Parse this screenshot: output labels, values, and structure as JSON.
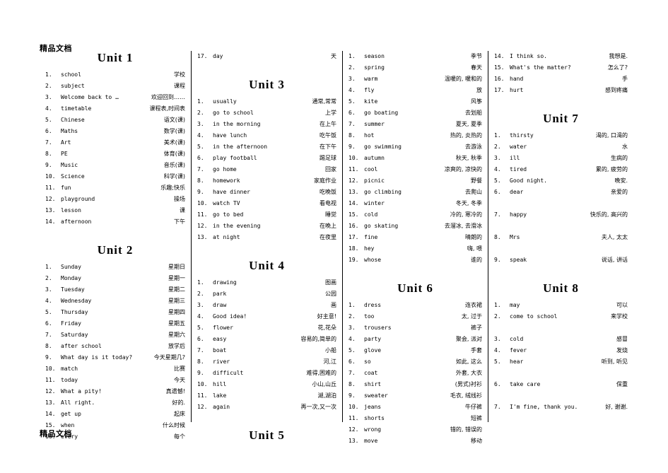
{
  "watermark": {
    "top": "精品文档",
    "bottom": "精品文档"
  },
  "columns": [
    {
      "blocks": [
        {
          "type": "unit",
          "title": "Unit 1",
          "entries": [
            {
              "n": "1.",
              "en": "school",
              "cn": "学校"
            },
            {
              "n": "2.",
              "en": "subject",
              "cn": "课程"
            },
            {
              "n": "3.",
              "en": "Welcome back to …",
              "cn": "欢迎回到……"
            },
            {
              "n": "4.",
              "en": "timetable",
              "cn": "课程表,时间表"
            },
            {
              "n": "5.",
              "en": "Chinese",
              "cn": "语文(课)"
            },
            {
              "n": "6.",
              "en": "Maths",
              "cn": "数学(课)"
            },
            {
              "n": "7.",
              "en": "Art",
              "cn": "美术(课)"
            },
            {
              "n": "8.",
              "en": "PE",
              "cn": "体育(课)"
            },
            {
              "n": "9.",
              "en": "Music",
              "cn": "音乐(课)"
            },
            {
              "n": "10.",
              "en": "Science",
              "cn": "科学(课)"
            },
            {
              "n": "11.",
              "en": "fun",
              "cn": "乐趣;快乐"
            },
            {
              "n": "12.",
              "en": "playground",
              "cn": "操场"
            },
            {
              "n": "13.",
              "en": "lesson",
              "cn": "课"
            },
            {
              "n": "14.",
              "en": "afternoon",
              "cn": "下午"
            }
          ]
        },
        {
          "type": "unit",
          "title": "Unit 2",
          "entries": [
            {
              "n": "1.",
              "en": "Sunday",
              "cn": "星期日"
            },
            {
              "n": "2.",
              "en": "Monday",
              "cn": "星期一"
            },
            {
              "n": "3.",
              "en": "Tuesday",
              "cn": "星期二"
            },
            {
              "n": "4.",
              "en": "Wednesday",
              "cn": "星期三"
            },
            {
              "n": "5.",
              "en": "Thursday",
              "cn": "星期四"
            },
            {
              "n": "6.",
              "en": "Friday",
              "cn": "星期五"
            },
            {
              "n": "7.",
              "en": "Saturday",
              "cn": "星期六"
            },
            {
              "n": "8.",
              "en": "after school",
              "cn": "放学后"
            },
            {
              "n": "9.",
              "en": "What day is it today?",
              "cn": "今天星期几?"
            },
            {
              "n": "10.",
              "en": "match",
              "cn": "比赛"
            },
            {
              "n": "11.",
              "en": "today",
              "cn": "今天"
            },
            {
              "n": "12.",
              "en": "What a pity!",
              "cn": "真遗憾!"
            },
            {
              "n": "13.",
              "en": "All right.",
              "cn": "好的."
            },
            {
              "n": "14.",
              "en": "get up",
              "cn": "起床"
            },
            {
              "n": "15.",
              "en": "when",
              "cn": "什么时候"
            },
            {
              "n": "16.",
              "en": "every",
              "cn": "每个"
            }
          ]
        }
      ]
    },
    {
      "blocks": [
        {
          "type": "entries-only",
          "entries": [
            {
              "n": "17.",
              "en": "day",
              "cn": "天"
            }
          ]
        },
        {
          "type": "unit",
          "title": "Unit 3",
          "entries": [
            {
              "n": "1.",
              "en": "usually",
              "cn": "通常,常常"
            },
            {
              "n": "2.",
              "en": "go to school",
              "cn": "上学"
            },
            {
              "n": "3.",
              "en": "in the morning",
              "cn": "在上午"
            },
            {
              "n": "4.",
              "en": "have lunch",
              "cn": "吃午饭"
            },
            {
              "n": "5.",
              "en": "in the afternoon",
              "cn": "在下午"
            },
            {
              "n": "6.",
              "en": "play football",
              "cn": "踢足球"
            },
            {
              "n": "7.",
              "en": "go home",
              "cn": "回家"
            },
            {
              "n": "8.",
              "en": "homework",
              "cn": "家庭作业"
            },
            {
              "n": "9.",
              "en": "have dinner",
              "cn": "吃晚饭"
            },
            {
              "n": "10.",
              "en": "watch TV",
              "cn": "看电视"
            },
            {
              "n": "11.",
              "en": "go to bed",
              "cn": "睡觉"
            },
            {
              "n": "12.",
              "en": "in the evening",
              "cn": "在晚上"
            },
            {
              "n": "13.",
              "en": "at night",
              "cn": "在夜里"
            }
          ]
        },
        {
          "type": "unit",
          "title": "Unit 4",
          "entries": [
            {
              "n": "1.",
              "en": "drawing",
              "cn": "图画"
            },
            {
              "n": "2.",
              "en": "park",
              "cn": "公园"
            },
            {
              "n": "3.",
              "en": "draw",
              "cn": "画"
            },
            {
              "n": "4.",
              "en": "Good idea!",
              "cn": "好主意!"
            },
            {
              "n": "5.",
              "en": "flower",
              "cn": "花,花朵"
            },
            {
              "n": "6.",
              "en": "easy",
              "cn": "容易的,简单的"
            },
            {
              "n": "7.",
              "en": "boat",
              "cn": "小船"
            },
            {
              "n": "8.",
              "en": "river",
              "cn": "河,江"
            },
            {
              "n": "9.",
              "en": "difficult",
              "cn": "难得,困难的"
            },
            {
              "n": "10.",
              "en": "hill",
              "cn": "小山,山丘"
            },
            {
              "n": "11.",
              "en": "lake",
              "cn": "湖,湖泊"
            },
            {
              "n": "12.",
              "en": "again",
              "cn": "再一次,又一次"
            }
          ]
        },
        {
          "type": "title-only",
          "title": "Unit 5"
        }
      ]
    },
    {
      "blocks": [
        {
          "type": "entries-only",
          "entries": [
            {
              "n": "1.",
              "en": "season",
              "cn": "季节"
            },
            {
              "n": "2.",
              "en": "spring",
              "cn": "春天"
            },
            {
              "n": "3.",
              "en": "warm",
              "cn": "温暖的, 暖和的"
            },
            {
              "n": "4.",
              "en": "fly",
              "cn": "放"
            },
            {
              "n": "5.",
              "en": "kite",
              "cn": "风筝"
            },
            {
              "n": "6.",
              "en": "go boating",
              "cn": "去划船"
            },
            {
              "n": "7.",
              "en": "summer",
              "cn": "夏天, 夏季"
            },
            {
              "n": "8.",
              "en": "hot",
              "cn": "热的, 炎热的"
            },
            {
              "n": "9.",
              "en": "go swimming",
              "cn": "去游泳"
            },
            {
              "n": "10.",
              "en": "autumn",
              "cn": "秋天, 秋季"
            },
            {
              "n": "11.",
              "en": "cool",
              "cn": "凉爽的, 凉快的"
            },
            {
              "n": "12.",
              "en": "picnic",
              "cn": "野餐"
            },
            {
              "n": "13.",
              "en": "go climbing",
              "cn": "去爬山"
            },
            {
              "n": "14.",
              "en": "winter",
              "cn": "冬天, 冬季"
            },
            {
              "n": "15.",
              "en": "cold",
              "cn": "冷的, 寒冷的"
            },
            {
              "n": "16.",
              "en": "go skating",
              "cn": "去溜冰, 去滑冰"
            },
            {
              "n": "17.",
              "en": "fine",
              "cn": "晴朗的"
            },
            {
              "n": "18.",
              "en": "hey",
              "cn": "嗨, 喂"
            },
            {
              "n": "19.",
              "en": "whose",
              "cn": "谁的"
            }
          ]
        },
        {
          "type": "unit",
          "title": "Unit 6",
          "entries": [
            {
              "n": "1.",
              "en": "dress",
              "cn": "连衣裙"
            },
            {
              "n": "2.",
              "en": "too",
              "cn": "太, 过于"
            },
            {
              "n": "3.",
              "en": "trousers",
              "cn": "裤子"
            },
            {
              "n": "4.",
              "en": "party",
              "cn": "聚会, 派对"
            },
            {
              "n": "5.",
              "en": "glove",
              "cn": "手套"
            },
            {
              "n": "6.",
              "en": "so",
              "cn": "如此, 这么"
            },
            {
              "n": "7.",
              "en": "coat",
              "cn": "外套, 大衣"
            },
            {
              "n": "8.",
              "en": "shirt",
              "cn": "(男式)衬衫"
            },
            {
              "n": "9.",
              "en": "sweater",
              "cn": "毛衣, 绒线衫"
            },
            {
              "n": "10.",
              "en": "jeans",
              "cn": "牛仔裤"
            },
            {
              "n": "11.",
              "en": "shorts",
              "cn": "短裤"
            },
            {
              "n": "12.",
              "en": "wrong",
              "cn": "错的, 错误的"
            },
            {
              "n": "13.",
              "en": "move",
              "cn": "移动"
            }
          ]
        }
      ]
    },
    {
      "blocks": [
        {
          "type": "entries-only",
          "entries": [
            {
              "n": "14.",
              "en": "I think so.",
              "cn": "我想是."
            },
            {
              "n": "15.",
              "en": "What's the matter?",
              "cn": "怎么了?"
            },
            {
              "n": "16.",
              "en": "hand",
              "cn": "手"
            },
            {
              "n": "17.",
              "en": "hurt",
              "cn": "感到疼痛"
            }
          ]
        },
        {
          "type": "unit",
          "title": "Unit 7",
          "entries": [
            {
              "n": "1.",
              "en": "thirsty",
              "cn": "渴的, 口渴的"
            },
            {
              "n": "2.",
              "en": "water",
              "cn": "水"
            },
            {
              "n": "3.",
              "en": "ill",
              "cn": "生病的"
            },
            {
              "n": "4.",
              "en": "tired",
              "cn": "累的, 疲劳的"
            },
            {
              "n": "5.",
              "en": "Good night.",
              "cn": "晚安."
            },
            {
              "n": "6.",
              "en": "dear",
              "cn": "亲爱的"
            },
            {
              "n": "",
              "en": "",
              "cn": ""
            },
            {
              "n": "7.",
              "en": "happy",
              "cn": "快乐的, 高兴的"
            },
            {
              "n": "",
              "en": "",
              "cn": ""
            },
            {
              "n": "8.",
              "en": "Mrs",
              "cn": "夫人, 太太"
            },
            {
              "n": "",
              "en": "",
              "cn": ""
            },
            {
              "n": "9.",
              "en": "speak",
              "cn": "说话, 讲话"
            }
          ]
        },
        {
          "type": "unit",
          "title": "Unit 8",
          "entries": [
            {
              "n": "1.",
              "en": "may",
              "cn": "可以"
            },
            {
              "n": "2.",
              "en": "come to school",
              "cn": "来学校"
            },
            {
              "n": "",
              "en": "",
              "cn": ""
            },
            {
              "n": "3.",
              "en": "cold",
              "cn": "感冒"
            },
            {
              "n": "4.",
              "en": "fever",
              "cn": "发烧"
            },
            {
              "n": "5.",
              "en": "hear",
              "cn": "听到, 听见"
            },
            {
              "n": "",
              "en": "",
              "cn": ""
            },
            {
              "n": "6.",
              "en": "take care",
              "cn": "保重"
            },
            {
              "n": "",
              "en": "",
              "cn": ""
            },
            {
              "n": "7.",
              "en": "I'm fine, thank you.",
              "cn": "好, 谢谢."
            }
          ]
        }
      ]
    }
  ]
}
